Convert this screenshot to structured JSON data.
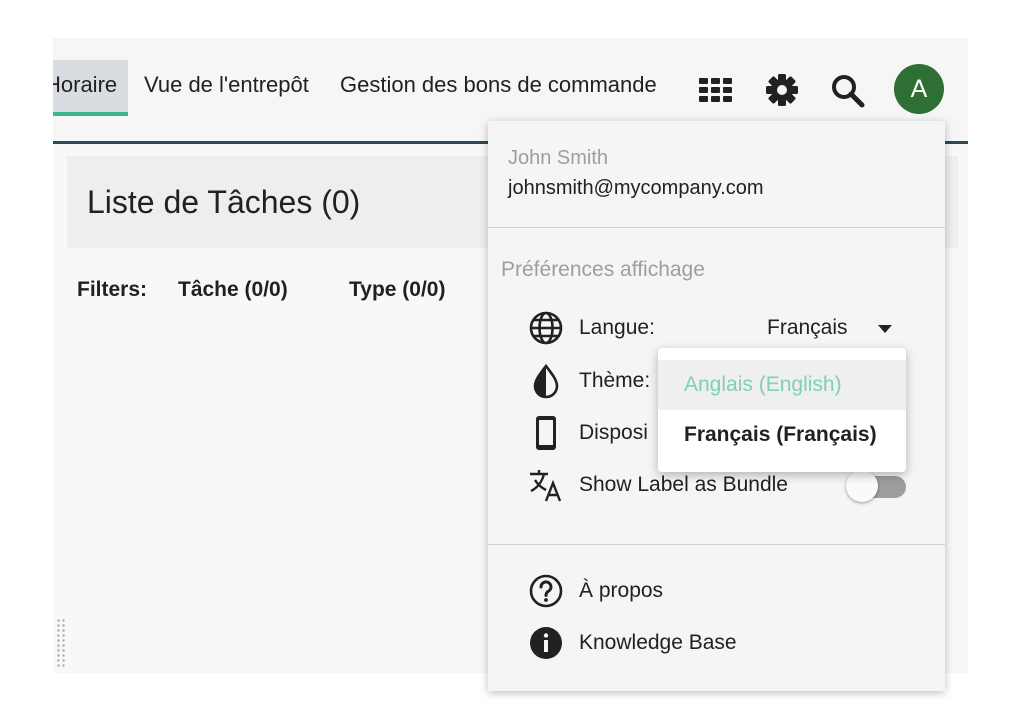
{
  "nav": {
    "tabs": [
      {
        "label": "Horaire",
        "active": true
      },
      {
        "label": "Vue de l'entrepôt"
      },
      {
        "label": "Gestion des bons de commande"
      }
    ],
    "icons": [
      "apps-grid-icon",
      "gear-icon",
      "search-icon"
    ],
    "avatar_initial": "A"
  },
  "main": {
    "title": "Liste de Tâches (0)",
    "filters_label": "Filters:",
    "filters": [
      "Tâche (0/0)",
      "Type (0/0)"
    ]
  },
  "user_menu": {
    "name": "John Smith",
    "email": "johnsmith@mycompany.com",
    "section_title": "Préférences affichage",
    "language": {
      "label": "Langue:",
      "value": "Français"
    },
    "theme": {
      "label": "Thème:"
    },
    "device": {
      "label": "Disposi"
    },
    "bundle": {
      "label": "Show Label as Bundle",
      "enabled": false
    },
    "about": "À propos",
    "knowledge_base": "Knowledge Base"
  },
  "language_options": [
    {
      "label": "Anglais (English)",
      "hovered": true
    },
    {
      "label": "Français (Français)",
      "selected": true
    }
  ],
  "colors": {
    "accent": "#3eb489",
    "avatar": "#2e6f34",
    "topbar_border": "#2b4a55",
    "hover_text": "#7fd1b0"
  }
}
